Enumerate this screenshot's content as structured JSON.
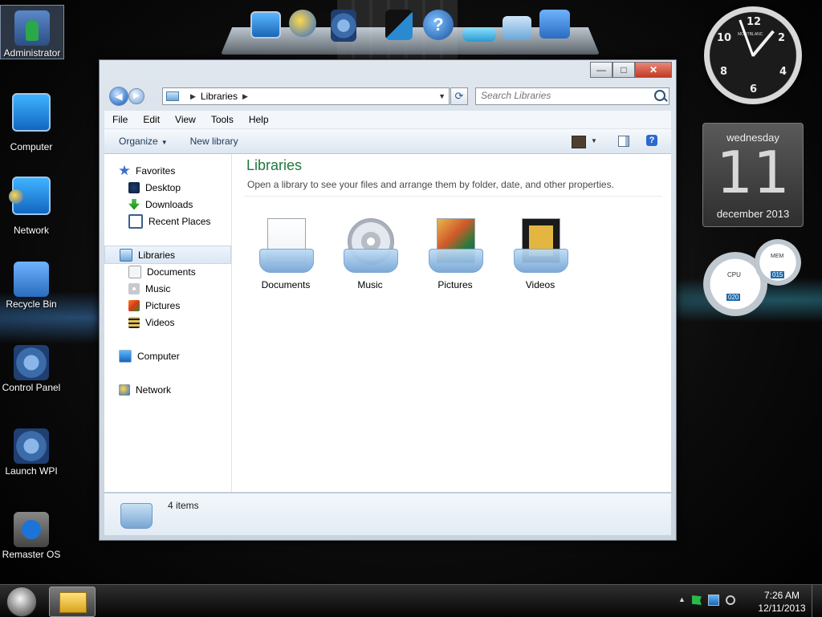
{
  "desktop": {
    "icons": [
      {
        "label": "Administrator",
        "icon": "user-folder-icon"
      },
      {
        "label": "Computer",
        "icon": "computer-icon"
      },
      {
        "label": "Network",
        "icon": "network-icon"
      },
      {
        "label": "Recycle Bin",
        "icon": "recycle-bin-icon"
      },
      {
        "label": "Control Panel",
        "icon": "control-panel-icon"
      },
      {
        "label": "Launch WPI",
        "icon": "launch-wpi-icon"
      },
      {
        "label": "Remaster OS",
        "icon": "internet-explorer-icon"
      }
    ]
  },
  "gadgets": {
    "calendar": {
      "weekday": "wednesday",
      "day": "11",
      "month_year": "december 2013"
    },
    "clock_numbers": [
      "12",
      "2",
      "4",
      "6",
      "8",
      "10"
    ],
    "clock_brand": "MONTBLANC",
    "meter": {
      "cpu_label": "CPU",
      "cpu_value": "020",
      "mem_label": "MEM",
      "mem_value": "015"
    }
  },
  "explorer": {
    "address": {
      "crumb": "Libraries"
    },
    "search": {
      "placeholder": "Search Libraries"
    },
    "window_buttons": {
      "minimize": "—",
      "maximize": "□",
      "close": "✕"
    },
    "menu": [
      "File",
      "Edit",
      "View",
      "Tools",
      "Help"
    ],
    "toolbar": {
      "organize": "Organize",
      "new_library": "New library",
      "help": "?"
    },
    "nav": {
      "favorites": "Favorites",
      "desktop": "Desktop",
      "downloads": "Downloads",
      "recent_places": "Recent Places",
      "libraries": "Libraries",
      "documents": "Documents",
      "music": "Music",
      "pictures": "Pictures",
      "videos": "Videos",
      "computer": "Computer",
      "network": "Network"
    },
    "main": {
      "title": "Libraries",
      "description": "Open a library to see your files and arrange them by folder, date, and other properties.",
      "libraries": [
        {
          "label": "Documents"
        },
        {
          "label": "Music"
        },
        {
          "label": "Pictures"
        },
        {
          "label": "Videos"
        }
      ]
    },
    "status": {
      "count": "4 items"
    }
  },
  "taskbar": {
    "time": "7:26 AM",
    "date": "12/11/2013"
  }
}
